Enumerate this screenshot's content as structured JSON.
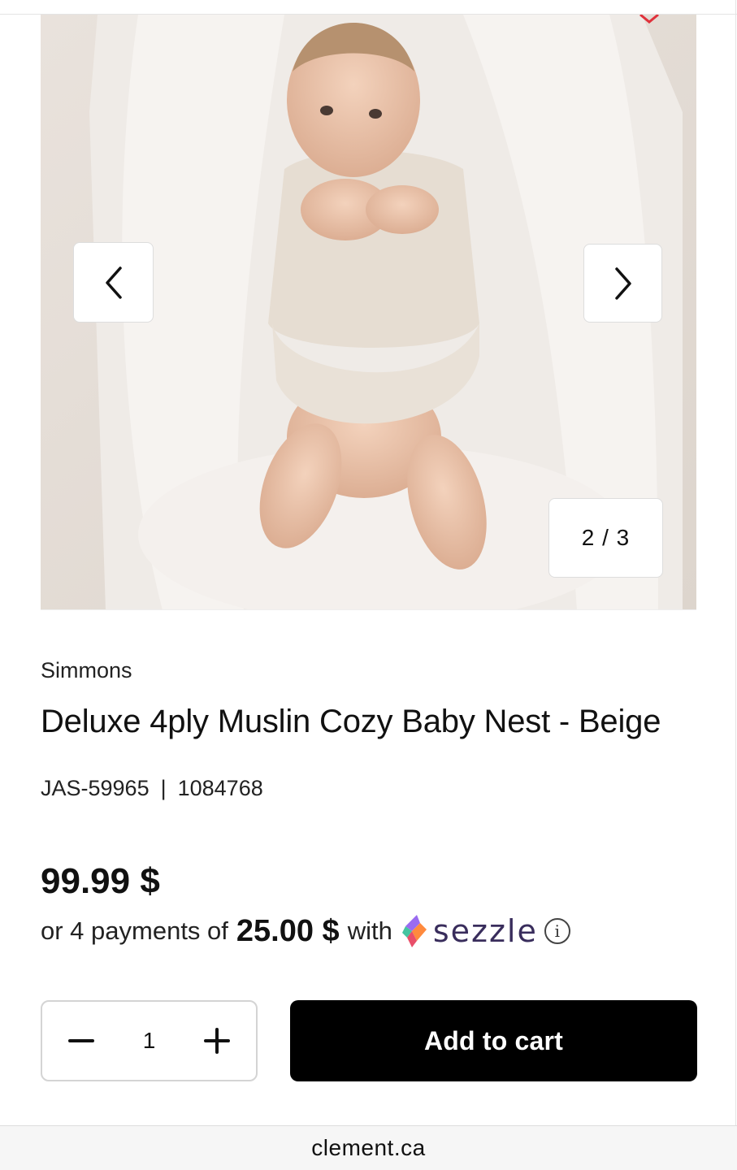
{
  "gallery": {
    "image_alt": "Baby lying in a beige muslin baby nest",
    "counter": "2 / 3",
    "prev_icon": "chevron-left-icon",
    "next_icon": "chevron-right-icon"
  },
  "product": {
    "brand": "Simmons",
    "title": "Deluxe 4ply Muslin Cozy Baby Nest - Beige",
    "sku": "JAS-59965",
    "sku_separator": "|",
    "item_number": "1084768",
    "price": "99.99 $"
  },
  "installments": {
    "prefix": "or 4 payments of",
    "amount": "25.00 $",
    "with": "with",
    "provider": "sezzle",
    "info_symbol": "i"
  },
  "cart": {
    "quantity": "1",
    "decrement_icon": "minus-icon",
    "increment_icon": "plus-icon",
    "add_to_cart_label": "Add to cart"
  },
  "browser": {
    "url": "clement.ca"
  },
  "colors": {
    "button_bg": "#000000",
    "sezzle_text": "#392d5c",
    "wishlist": "#e0313b"
  }
}
